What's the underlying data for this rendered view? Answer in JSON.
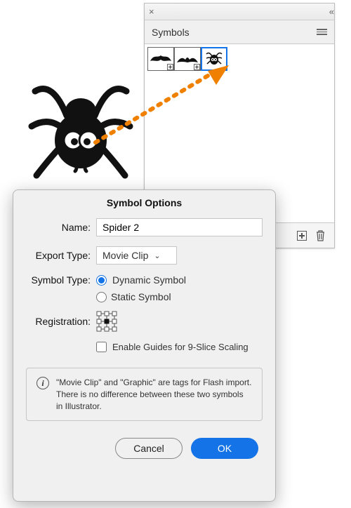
{
  "panel": {
    "title": "Symbols",
    "thumbs": [
      "bats-1",
      "bats-2",
      "spider"
    ],
    "selected_index": 2
  },
  "dialog": {
    "title": "Symbol Options",
    "name_label": "Name:",
    "name_value": "Spider 2",
    "export_label": "Export Type:",
    "export_value": "Movie Clip",
    "symtype_label": "Symbol Type:",
    "radio_dynamic": "Dynamic Symbol",
    "radio_static": "Static Symbol",
    "registration_label": "Registration:",
    "enable_guides": "Enable Guides for 9-Slice Scaling",
    "info_text": "\"Movie Clip\" and \"Graphic\" are tags for Flash import. There is no difference between these two symbols in Illustrator.",
    "cancel": "Cancel",
    "ok": "OK"
  }
}
